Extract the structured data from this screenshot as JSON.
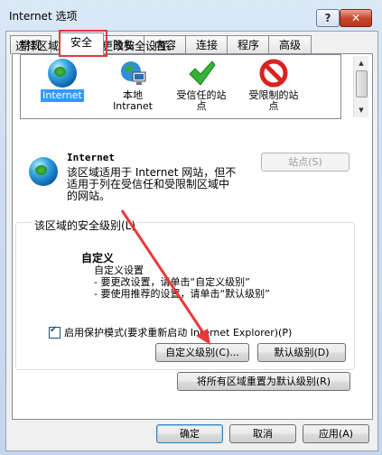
{
  "window": {
    "title": "Internet 选项",
    "help_glyph": "?",
    "close_glyph": "✕"
  },
  "tabs": [
    {
      "label": "常规"
    },
    {
      "label": "安全",
      "active": true
    },
    {
      "label": "隐私"
    },
    {
      "label": "内容"
    },
    {
      "label": "连接"
    },
    {
      "label": "程序"
    },
    {
      "label": "高级"
    }
  ],
  "security": {
    "instruction": "选择区域以查看或更改安全设置。",
    "zones": [
      {
        "label": "Internet",
        "icon": "globe-icon",
        "selected": true
      },
      {
        "label": "本地\nIntranet",
        "icon": "intranet-icon"
      },
      {
        "label": "受信任的站\n点",
        "icon": "trusted-check-icon"
      },
      {
        "label": "受限制的站\n点",
        "icon": "restricted-icon"
      }
    ],
    "zone_name": "Internet",
    "zone_description": "该区域适用于 Internet 网站，但不适用于列在受信任和受限制区域中的网站。",
    "sites_button": "站点(S)",
    "level_group_title": "该区域的安全级别(L)",
    "custom_title": "自定义",
    "custom_lines": "自定义设置\n- 要更改设置，请单击“自定义级别”\n- 要使用推荐的设置，请单击“默认级别”",
    "protected_mode_label": "启用保护模式(要求重新启动 Internet Explorer)(P)",
    "protected_mode_checked": true,
    "custom_level_button": "自定义级别(C)...",
    "default_level_button": "默认级别(D)",
    "reset_all_button": "将所有区域重置为默认级别(R)"
  },
  "footer": {
    "ok": "确定",
    "cancel": "取消",
    "apply": "应用(A)"
  },
  "colors": {
    "highlight_box": "#e23a3a",
    "arrow": "#e8393b",
    "selection": "#3399ff"
  }
}
